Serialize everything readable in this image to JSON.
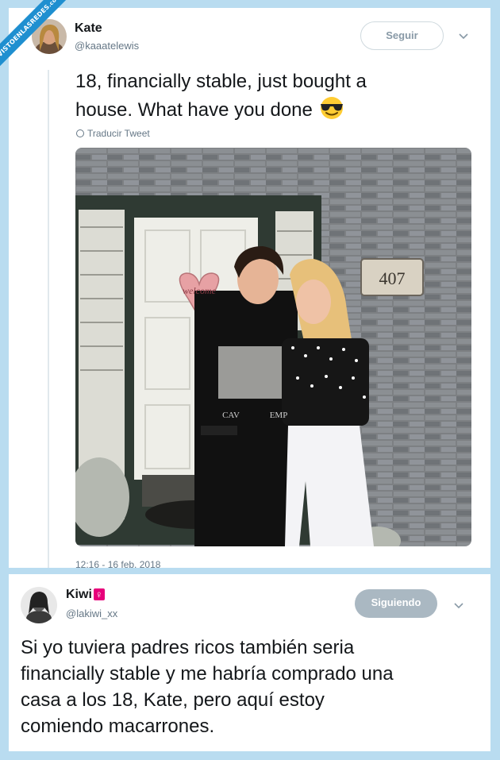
{
  "watermark": {
    "text": "VISTOENLASREDES",
    "suffix": ".com"
  },
  "tweet1": {
    "name": "Kate",
    "handle": "@kaaatelewis",
    "follow_label": "Seguir",
    "text_line1": "18, financially stable, just bought a",
    "text_line2": "house. What have you done",
    "emoji": "sunglasses-emoji",
    "translate_label": "Traducir Tweet",
    "photo": {
      "door_sign": "welcome",
      "house_number": "407",
      "shirt_text_left": "CAV",
      "shirt_text_right": "EMP"
    },
    "timestamp": "12:16 - 16 feb. 2018"
  },
  "tweet2": {
    "name": "Kiwi",
    "name_symbol": "♀",
    "handle": "@lakiwi_xx",
    "follow_label": "Siguiendo",
    "text_lines": [
      "Si yo tuviera padres ricos también seria",
      "financially stable y me habría comprado una",
      "casa a los 18, Kate, pero aquí estoy",
      "comiendo macarrones."
    ]
  },
  "colors": {
    "background": "#b9dcf0",
    "watermark": "#1f8fd0",
    "follow_border": "#cfd9de",
    "following_bg": "#aab8c2"
  }
}
